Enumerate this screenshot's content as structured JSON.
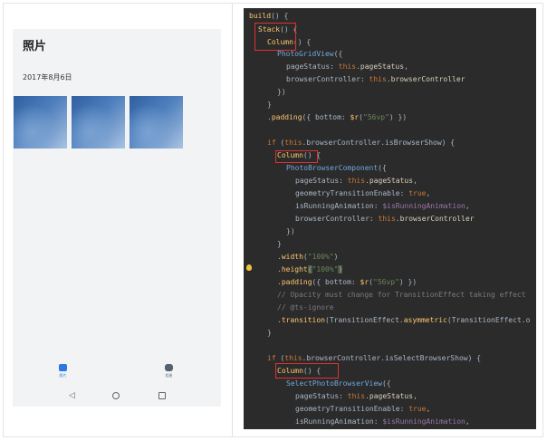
{
  "phone": {
    "title": "照片",
    "date": "2017年8月6日",
    "photos": [
      "photo-1",
      "photo-2",
      "photo-3"
    ],
    "tabs": [
      {
        "label": "照片",
        "icon": "photos-icon",
        "active": true
      },
      {
        "label": "相册",
        "icon": "albums-icon",
        "active": false
      }
    ],
    "nav": {
      "back": "◁",
      "home": "",
      "recent": ""
    }
  },
  "editor": {
    "lines": [
      "build() {",
      "  Stack() {",
      "    Column() {",
      "      PhotoGridView({",
      "        pageStatus: this.pageStatus,",
      "        browserController: this.browserController",
      "      })",
      "    }",
      "    .padding({ bottom: $r(\"56vp\") })",
      "",
      "    if (this.browserController.isBrowserShow) {",
      "      Column() {",
      "        PhotoBrowserComponent({",
      "          pageStatus: this.pageStatus,",
      "          geometryTransitionEnable: true,",
      "          isRunningAnimation: $isRunningAnimation,",
      "          browserController: this.browserController",
      "        })",
      "      }",
      "      .width(\"100%\")",
      "      .height(\"100%\")",
      "      .padding({ bottom: $r(\"56vp\") })",
      "      // Opacity must change for TransitionEffect taking effect",
      "      // @ts-ignore",
      "      .transition(TransitionEffect.asymmetric(TransitionEffect.o",
      "    }",
      "",
      "    if (this.browserController.isSelectBrowserShow) {",
      "      Column() {",
      "        SelectPhotoBrowserView({",
      "          pageStatus: this.pageStatus,",
      "          geometryTransitionEnable: true,",
      "          isRunningAnimation: $isRunningAnimation,"
    ]
  },
  "colors": {
    "editor_bg": "#2b2b2b",
    "keyword": "#cc7832",
    "function": "#ffc66d",
    "string": "#6a8759",
    "comment": "#7a7a7a",
    "highlight_box": "#e03030",
    "accent": "#2f77e0"
  }
}
